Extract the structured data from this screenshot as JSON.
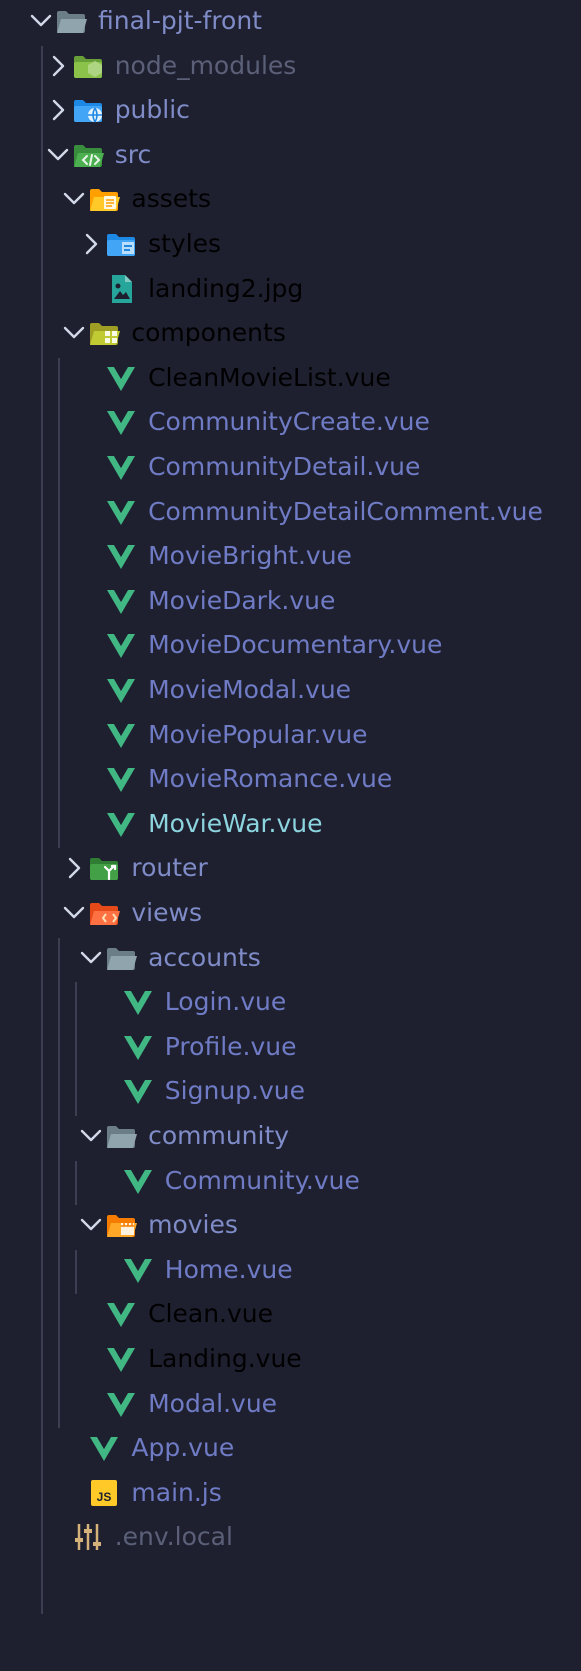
{
  "explorer": {
    "colors": {
      "background": "#1e2030",
      "guide": "#3b3f51",
      "chevron": "#d3d8e8",
      "label_default": "#7f8cc7",
      "label_ignored": "#5b6078",
      "label_modified": "#8fa15f",
      "label_active": "#8cd4de",
      "vue_icon": "#41b883"
    },
    "items": [
      {
        "label": "final-pjt-front",
        "depth": 0,
        "type": "folder",
        "expanded": true,
        "icon": "folder-open-icon",
        "color": "folder"
      },
      {
        "label": "node_modules",
        "depth": 1,
        "type": "folder",
        "expanded": false,
        "icon": "node-folder-icon",
        "color": "dim"
      },
      {
        "label": "public",
        "depth": 1,
        "type": "folder",
        "expanded": false,
        "icon": "public-folder-icon",
        "color": "folder"
      },
      {
        "label": "src",
        "depth": 1,
        "type": "folder",
        "expanded": true,
        "icon": "src-folder-icon",
        "color": "folder"
      },
      {
        "label": "assets",
        "depth": 2,
        "type": "folder",
        "expanded": true,
        "icon": "assets-folder-icon",
        "color": "modified"
      },
      {
        "label": "styles",
        "depth": 3,
        "type": "folder",
        "expanded": false,
        "icon": "styles-folder-icon",
        "color": "modified"
      },
      {
        "label": "landing2.jpg",
        "depth": 3,
        "type": "file",
        "icon": "image-file-icon",
        "color": "modified"
      },
      {
        "label": "components",
        "depth": 2,
        "type": "folder",
        "expanded": true,
        "icon": "components-folder-icon",
        "color": "modified"
      },
      {
        "label": "CleanMovieList.vue",
        "depth": 3,
        "type": "file",
        "icon": "vue-file-icon",
        "color": "modified"
      },
      {
        "label": "CommunityCreate.vue",
        "depth": 3,
        "type": "file",
        "icon": "vue-file-icon",
        "color": "vue"
      },
      {
        "label": "CommunityDetail.vue",
        "depth": 3,
        "type": "file",
        "icon": "vue-file-icon",
        "color": "vue"
      },
      {
        "label": "CommunityDetailComment.vue",
        "depth": 3,
        "type": "file",
        "icon": "vue-file-icon",
        "color": "vue"
      },
      {
        "label": "MovieBright.vue",
        "depth": 3,
        "type": "file",
        "icon": "vue-file-icon",
        "color": "vue"
      },
      {
        "label": "MovieDark.vue",
        "depth": 3,
        "type": "file",
        "icon": "vue-file-icon",
        "color": "vue"
      },
      {
        "label": "MovieDocumentary.vue",
        "depth": 3,
        "type": "file",
        "icon": "vue-file-icon",
        "color": "vue"
      },
      {
        "label": "MovieModal.vue",
        "depth": 3,
        "type": "file",
        "icon": "vue-file-icon",
        "color": "vue"
      },
      {
        "label": "MoviePopular.vue",
        "depth": 3,
        "type": "file",
        "icon": "vue-file-icon",
        "color": "vue"
      },
      {
        "label": "MovieRomance.vue",
        "depth": 3,
        "type": "file",
        "icon": "vue-file-icon",
        "color": "vue"
      },
      {
        "label": "MovieWar.vue",
        "depth": 3,
        "type": "file",
        "icon": "vue-file-icon",
        "color": "active"
      },
      {
        "label": "router",
        "depth": 2,
        "type": "folder",
        "expanded": false,
        "icon": "router-folder-icon",
        "color": "folder"
      },
      {
        "label": "views",
        "depth": 2,
        "type": "folder",
        "expanded": true,
        "icon": "views-folder-icon",
        "color": "folder"
      },
      {
        "label": "accounts",
        "depth": 3,
        "type": "folder",
        "expanded": true,
        "icon": "folder-open-icon",
        "color": "folder"
      },
      {
        "label": "Login.vue",
        "depth": 4,
        "type": "file",
        "icon": "vue-file-icon",
        "color": "vue"
      },
      {
        "label": "Profile.vue",
        "depth": 4,
        "type": "file",
        "icon": "vue-file-icon",
        "color": "vue"
      },
      {
        "label": "Signup.vue",
        "depth": 4,
        "type": "file",
        "icon": "vue-file-icon",
        "color": "vue"
      },
      {
        "label": "community",
        "depth": 3,
        "type": "folder",
        "expanded": true,
        "icon": "folder-open-icon",
        "color": "folder"
      },
      {
        "label": "Community.vue",
        "depth": 4,
        "type": "file",
        "icon": "vue-file-icon",
        "color": "vue"
      },
      {
        "label": "movies",
        "depth": 3,
        "type": "folder",
        "expanded": true,
        "icon": "movies-folder-icon",
        "color": "folder"
      },
      {
        "label": "Home.vue",
        "depth": 4,
        "type": "file",
        "icon": "vue-file-icon",
        "color": "vue"
      },
      {
        "label": "Clean.vue",
        "depth": 3,
        "type": "file",
        "icon": "vue-file-icon",
        "color": "modified"
      },
      {
        "label": "Landing.vue",
        "depth": 3,
        "type": "file",
        "icon": "vue-file-icon",
        "color": "modified"
      },
      {
        "label": "Modal.vue",
        "depth": 3,
        "type": "file",
        "icon": "vue-file-icon",
        "color": "vue"
      },
      {
        "label": "App.vue",
        "depth": 2,
        "type": "file",
        "icon": "vue-file-icon",
        "color": "vue"
      },
      {
        "label": "main.js",
        "depth": 2,
        "type": "file",
        "icon": "js-file-icon",
        "color": "vue"
      },
      {
        "label": ".env.local",
        "depth": 1,
        "type": "file",
        "icon": "settings-file-icon",
        "color": "dim"
      }
    ]
  }
}
